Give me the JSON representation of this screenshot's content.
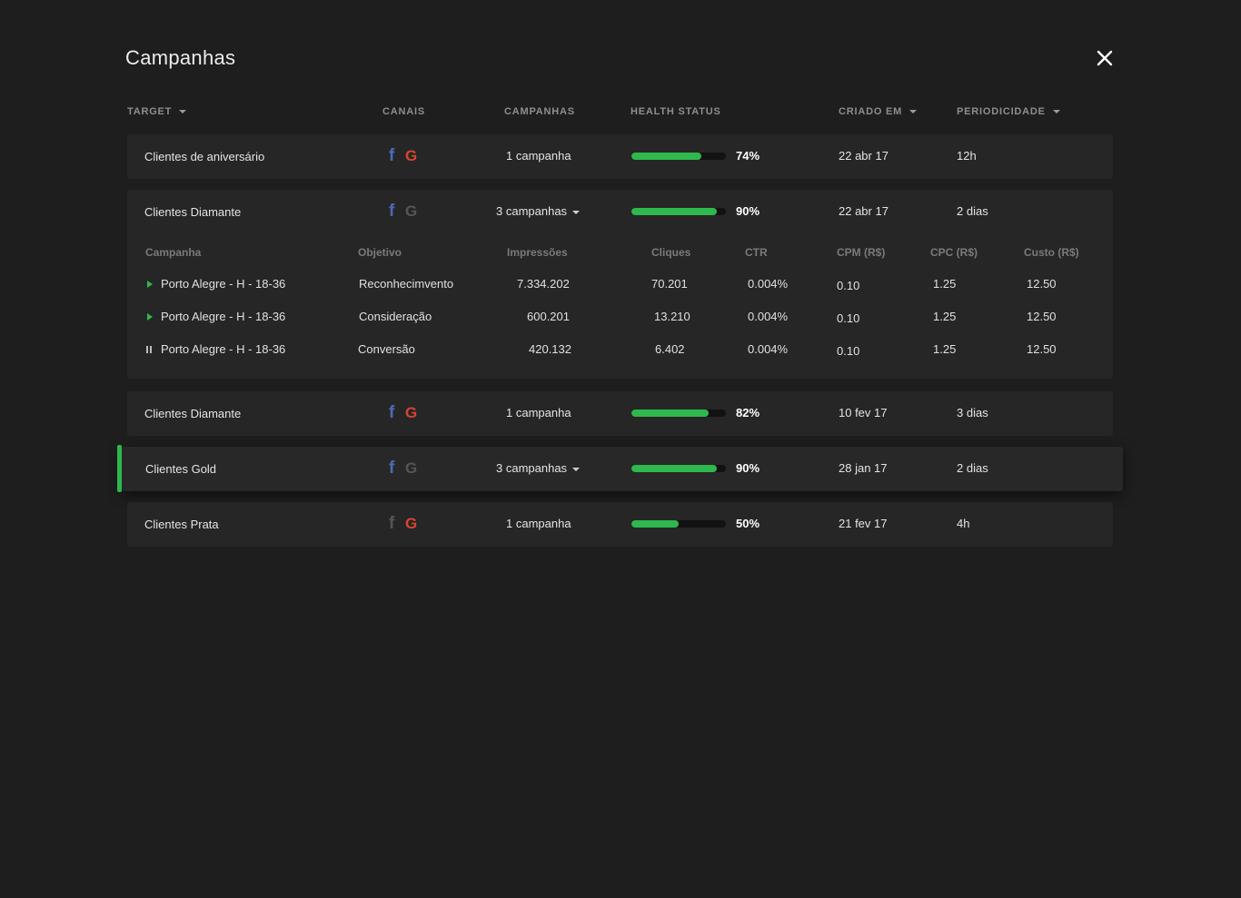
{
  "title": "Campanhas",
  "close_icon": "close-icon",
  "colors": {
    "accent": "#2fb84e",
    "facebook": "#4b6bb5",
    "google": "#d8432f",
    "background": "#1e1e1e",
    "row": "#262626"
  },
  "headers": {
    "target": "TARGET",
    "canais": "CANAIS",
    "campanhas": "CAMPANHAS",
    "health": "HEALTH STATUS",
    "criado": "CRIADO EM",
    "periodicidade": "PERIODICIDADE"
  },
  "rows": [
    {
      "target": "Clientes de aniversário",
      "facebook": true,
      "google": true,
      "campanhas": "1 campanha",
      "health": 74,
      "health_label": "74%",
      "criado": "22 abr 17",
      "periodicidade": "12h"
    },
    {
      "target": "Clientes Diamante",
      "facebook": true,
      "google": false,
      "campanhas": "3 campanhas",
      "health": 90,
      "health_label": "90%",
      "criado": "22 abr 17",
      "periodicidade": "2 dias"
    },
    {
      "target": "Clientes Diamante",
      "facebook": true,
      "google": true,
      "campanhas": "1 campanha",
      "health": 82,
      "health_label": "82%",
      "criado": "10 fev 17",
      "periodicidade": "3 dias"
    },
    {
      "target": "Clientes Gold",
      "facebook": true,
      "google": false,
      "campanhas": "3 campanhas",
      "health": 90,
      "health_label": "90%",
      "criado": "28 jan 17",
      "periodicidade": "2 dias"
    },
    {
      "target": "Clientes Prata",
      "facebook": false,
      "google": true,
      "campanhas": "1 campanha",
      "health": 50,
      "health_label": "50%",
      "criado": "21 fev 17",
      "periodicidade": "4h"
    }
  ],
  "subtable": {
    "headers": [
      "Campanha",
      "Objetivo",
      "Impressões",
      "Cliques",
      "CTR",
      "CPM (R$)",
      "CPC (R$)",
      "Custo (R$)"
    ],
    "rows": [
      {
        "status": "playing",
        "campanha": "Porto Alegre - H - 18-36",
        "objetivo": "Reconhecimvento",
        "impressoes": "7.334.202",
        "cliques": "70.201",
        "ctr": "0.004%",
        "cpm": "0.10",
        "cpc": "1.25",
        "custo": "12.50"
      },
      {
        "status": "playing",
        "campanha": "Porto Alegre - H - 18-36",
        "objetivo": "Consideração",
        "impressoes": "600.201",
        "cliques": "13.210",
        "ctr": "0.004%",
        "cpm": "0.10",
        "cpc": "1.25",
        "custo": "12.50"
      },
      {
        "status": "paused",
        "campanha": "Porto Alegre - H - 18-36",
        "objetivo": "Conversão",
        "impressoes": "420.132",
        "cliques": "6.402",
        "ctr": "0.004%",
        "cpm": "0.10",
        "cpc": "1.25",
        "custo": "12.50"
      }
    ]
  },
  "facebook_glyph": "f",
  "google_glyph": "G"
}
